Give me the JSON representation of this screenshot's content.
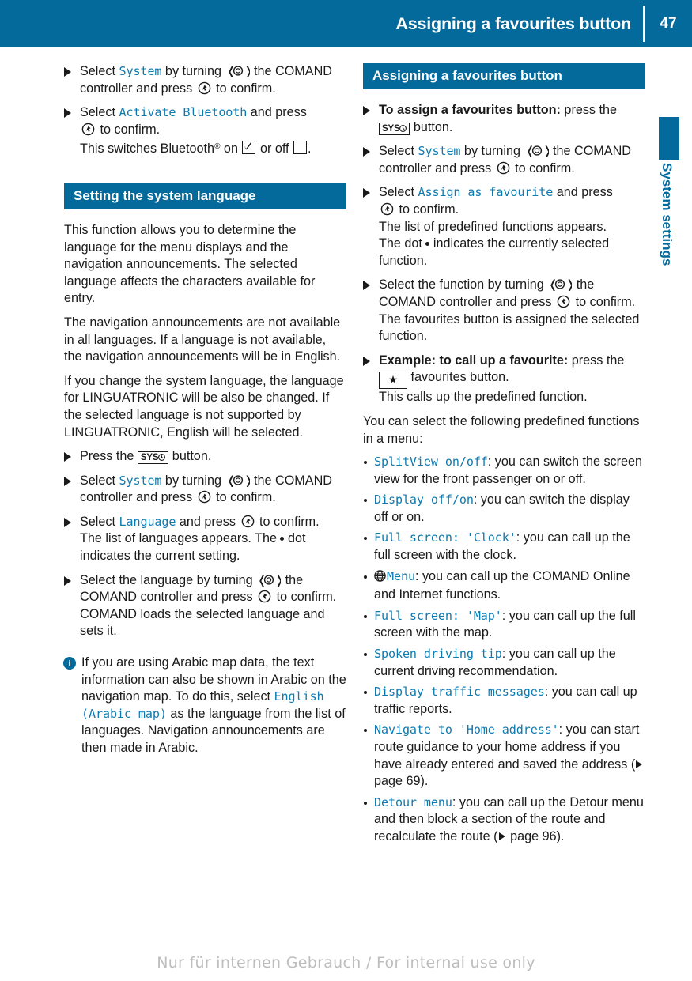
{
  "header": {
    "title": "Assigning a favourites button",
    "page_number": "47"
  },
  "side_tab": {
    "label": "System settings",
    "accent_color": "#046a9c"
  },
  "icons": {
    "rotate_controller": "rotate-comand-controller-icon",
    "press_controller": "press-comand-controller-icon",
    "sys_button": "sys-button-icon",
    "sys_button_text": "SYS",
    "favourites_button": "favourites-star-button-icon",
    "favourites_button_glyph": "★",
    "globe": "globe-icon",
    "checkbox_on": "checkbox-checked-icon",
    "checkbox_off": "checkbox-unchecked-icon",
    "info": "info-icon",
    "info_glyph": "i",
    "page_ref": "page-reference-triangle-icon"
  },
  "left_column": {
    "steps_top": [
      {
        "lead": "Select ",
        "mono1": "System",
        "mid": " by turning ",
        "after_rotate": " the COMAND controller and press ",
        "after_press": " to confirm."
      },
      {
        "lead": "Select ",
        "mono1": "Activate Bluetooth",
        "mid": " and press ",
        "after_press": " to confirm.",
        "sub_pre": "This switches Bluetooth",
        "sub_sup": "®",
        "sub_mid": " on ",
        "sub_mid2": " or off ",
        "sub_end": "."
      }
    ],
    "section_heading": "Setting the system language",
    "paragraphs": [
      "This function allows you to determine the language for the menu displays and the navigation announcements. The selected language affects the characters available for entry.",
      "The navigation announcements are not available in all languages. If a language is not available, the navigation announcements will be in English.",
      "If you change the system language, the language for LINGUATRONIC will be also be changed. If the selected language is not supported by LINGUATRONIC, English will be selected."
    ],
    "steps_bottom": [
      {
        "lead": "Press the ",
        "after_sys": " button."
      },
      {
        "lead": "Select ",
        "mono1": "System",
        "mid": " by turning ",
        "after_rotate": " the COMAND controller and press ",
        "after_press": " to confirm."
      },
      {
        "lead": "Select ",
        "mono1": "Language",
        "mid": " and press ",
        "after_press": " to confirm.",
        "sub_pre": "The list of languages appears. The ",
        "sub_post": " dot indicates the current setting."
      },
      {
        "lead": "Select the language by turning ",
        "after_rotate": " the COMAND controller and press ",
        "after_press": " to confirm.",
        "sub": "COMAND loads the selected language and sets it."
      }
    ],
    "note": {
      "part1": "If you are using Arabic map data, the text information can also be shown in Arabic on the navigation map. To do this, select ",
      "mono": "English (Arabic map)",
      "part2": " as the language from the list of languages. Navigation announcements are then made in Arabic."
    }
  },
  "right_column": {
    "section_heading": "Assigning a favourites button",
    "steps": [
      {
        "bold_lead": "To assign a favourites button:",
        "after_bold": " press the ",
        "after_sys": " button."
      },
      {
        "lead": "Select ",
        "mono1": "System",
        "mid": " by turning ",
        "after_rotate": " the COMAND controller and press ",
        "after_press": " to confirm."
      },
      {
        "lead": "Select ",
        "mono1": "Assign as favourite",
        "mid": " and press ",
        "after_press": " to confirm.",
        "sub1": "The list of predefined functions appears.",
        "sub2_pre": "The dot ",
        "sub2_post": " indicates the currently selected function."
      },
      {
        "lead": "Select the function by turning ",
        "after_rotate": " the COMAND controller and press ",
        "after_press": " to confirm.",
        "sub": "The favourites button is assigned the selected function."
      },
      {
        "bold_lead": "Example: to call up a favourite:",
        "after_bold": " press the ",
        "after_fav": " favourites button.",
        "sub": "This calls up the predefined function."
      }
    ],
    "intro": "You can select the following predefined functions in a menu:",
    "bullets": [
      {
        "mono": "SplitView on/off",
        "text": ": you can switch the screen view for the front passenger on or off."
      },
      {
        "mono": "Display off/on",
        "text": ": you can switch the display off or on."
      },
      {
        "mono": "Full screen: 'Clock'",
        "text": ": you can call up the full screen with the clock."
      },
      {
        "icon": "globe-icon",
        "mono": "Menu",
        "text": ": you can call up the COMAND Online and Internet functions."
      },
      {
        "mono": "Full screen: 'Map'",
        "text": ": you can call up the full screen with the map."
      },
      {
        "mono": "Spoken driving tip",
        "text": ": you can call up the current driving recommendation."
      },
      {
        "mono": "Display traffic messages",
        "text": ": you can call up traffic reports."
      },
      {
        "mono": "Navigate to 'Home address'",
        "text_pre": ": you can start route guidance to your home address if you have already entered and saved the address (",
        "ref": " page 69",
        "text_post": ")."
      },
      {
        "mono": "Detour menu",
        "text_pre": ": you can call up the Detour menu and then block a section of the route and recalculate the route (",
        "ref": " page 96",
        "text_post": ")."
      }
    ]
  },
  "footer": {
    "watermark": "Nur für internen Gebrauch / For internal use only"
  }
}
